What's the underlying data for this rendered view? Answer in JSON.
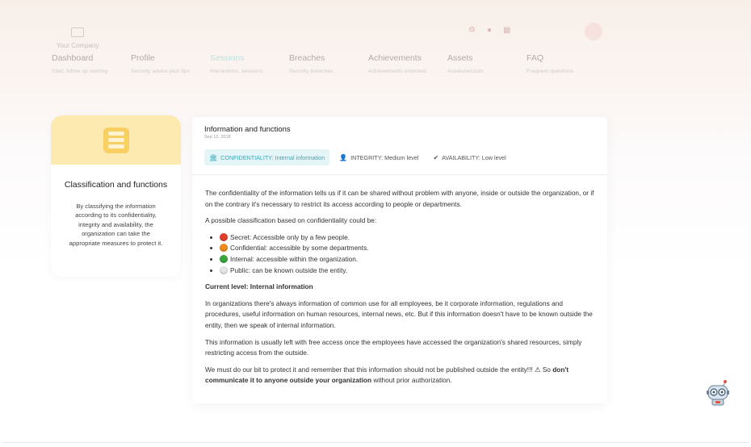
{
  "header": {
    "company": "Your Company",
    "icons": [
      "settings-icon",
      "bell-icon",
      "flag-icon"
    ]
  },
  "nav": [
    {
      "label": "Dashboard",
      "sub": "Start, follow up starting"
    },
    {
      "label": "Profile",
      "sub": "Security advice plus tips"
    },
    {
      "label": "Sessions",
      "sub": "Interactions, sessions"
    },
    {
      "label": "Breaches",
      "sub": "Security breaches"
    },
    {
      "label": "Achievements",
      "sub": "Achievements unlocked"
    },
    {
      "label": "Assets",
      "sub": "Assets/records"
    },
    {
      "label": "FAQ",
      "sub": "Frequent questions"
    }
  ],
  "left_card": {
    "title": "Classification and functions",
    "description": "By classifying the information according to its confidentiality, integrity and availability, the organization can take the appropriate measures to protect it."
  },
  "main": {
    "title": "Information and functions",
    "date": "Sep 12, 2018",
    "tabs": [
      {
        "label": "CONFIDENTIALITY: Internal information",
        "icon": "building-icon"
      },
      {
        "label": "INTEGRITY: Medium level",
        "icon": "user-shield-icon"
      },
      {
        "label": "AVAILABILITY: Low level",
        "icon": "double-check-icon"
      }
    ],
    "intro": "The confidentiality of the information tells us if it can be shared without problem with anyone, inside or outside the organization, or if on the contrary it's necessary to restrict its access according to people or departments.",
    "classification_intro": "A possible classification based on confidentiality could be:",
    "levels": [
      {
        "text": "Secret: Accessible only by a few people.",
        "color": "#e2402d"
      },
      {
        "text": "Confidential: accessible by some departments.",
        "color": "#f08a1c"
      },
      {
        "text": "Internal: accessible within the organization.",
        "color": "#3aa53a"
      },
      {
        "text": "Public: can be known outside the entity.",
        "color": "#e6e6e6"
      }
    ],
    "current_level": "Current level: Internal information",
    "paragraph1": "In organizations there's always information of common use for all employees, be it corporate information, regulations and procedures, useful information on human resources, internal news, etc. But if this information doesn't have to be known outside the entity, then we speak of internal information.",
    "paragraph2": "This information is usually left with free access once the employees have accessed the organization's shared resources, simply restricting access from the outside.",
    "closing_start": "We must do our bit to protect it and remember that this information should not be published outside the entity!!! ⚠ So",
    "closing_bold": "don't communicate it to anyone outside your organization",
    "closing_end": "without prior authorization."
  },
  "assistant": {
    "icon": "robot-assistant-icon"
  }
}
